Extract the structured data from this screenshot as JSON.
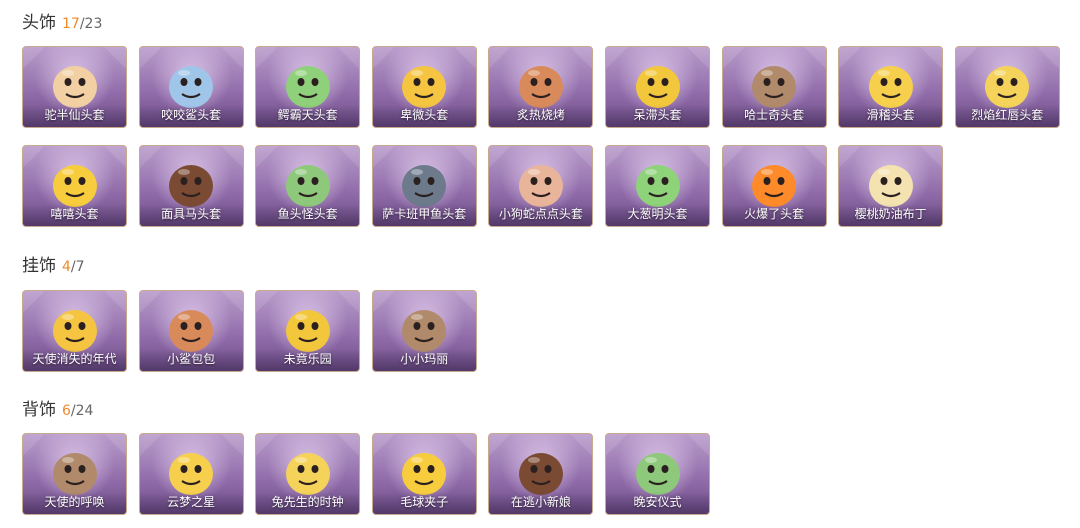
{
  "sections": [
    {
      "title": "头饰",
      "owned": "17",
      "total": "23",
      "items": [
        {
          "label": "驼半仙头套",
          "icon": "panda-mask-icon"
        },
        {
          "label": "咬咬鲨头套",
          "icon": "shark-mask-icon"
        },
        {
          "label": "鳄霸天头套",
          "icon": "crocodile-mask-icon"
        },
        {
          "label": "卑微头套",
          "icon": "worried-face-mask-icon"
        },
        {
          "label": "炙热烧烤",
          "icon": "bbq-mask-icon"
        },
        {
          "label": "呆滞头套",
          "icon": "dazed-face-mask-icon"
        },
        {
          "label": "哈士奇头套",
          "icon": "husky-mask-icon"
        },
        {
          "label": "滑稽头套",
          "icon": "funny-face-mask-icon"
        },
        {
          "label": "烈焰红唇头套",
          "icon": "red-lips-mask-icon"
        },
        {
          "label": "嘻嘻头套",
          "icon": "grin-face-mask-icon"
        },
        {
          "label": "面具马头套",
          "icon": "horse-mask-icon"
        },
        {
          "label": "鱼头怪头套",
          "icon": "fish-head-mask-icon"
        },
        {
          "label": "萨卡班甲鱼头套",
          "icon": "sacabambaspis-mask-icon"
        },
        {
          "label": "小狗蛇点点头套",
          "icon": "snake-mask-icon"
        },
        {
          "label": "大葱明头套",
          "icon": "green-onion-mask-icon"
        },
        {
          "label": "火爆了头套",
          "icon": "fire-mask-icon"
        },
        {
          "label": "樱桃奶油布丁",
          "icon": "pudding-mask-icon"
        }
      ]
    },
    {
      "title": "挂饰",
      "owned": "4",
      "total": "7",
      "items": [
        {
          "label": "天使消失的年代",
          "icon": "angel-charm-icon"
        },
        {
          "label": "小鲨包包",
          "icon": "shark-bag-charm-icon"
        },
        {
          "label": "未竟乐园",
          "icon": "paradise-charm-icon"
        },
        {
          "label": "小小玛丽",
          "icon": "mary-doll-charm-icon"
        }
      ]
    },
    {
      "title": "背饰",
      "owned": "6",
      "total": "24",
      "items": [
        {
          "label": "天使的呼唤",
          "icon": "angel-back-icon"
        },
        {
          "label": "云梦之星",
          "icon": "unicorn-back-icon"
        },
        {
          "label": "兔先生的时钟",
          "icon": "rabbit-clock-back-icon"
        },
        {
          "label": "毛球夹子",
          "icon": "raccoon-clip-back-icon"
        },
        {
          "label": "在逃小新娘",
          "icon": "bride-back-icon"
        },
        {
          "label": "晚安仪式",
          "icon": "goodnight-back-icon"
        }
      ]
    }
  ],
  "colors": {
    "owned": "#ee8a2a",
    "card_border": "#c9a98d",
    "card_purple": "#8f6aa8"
  }
}
